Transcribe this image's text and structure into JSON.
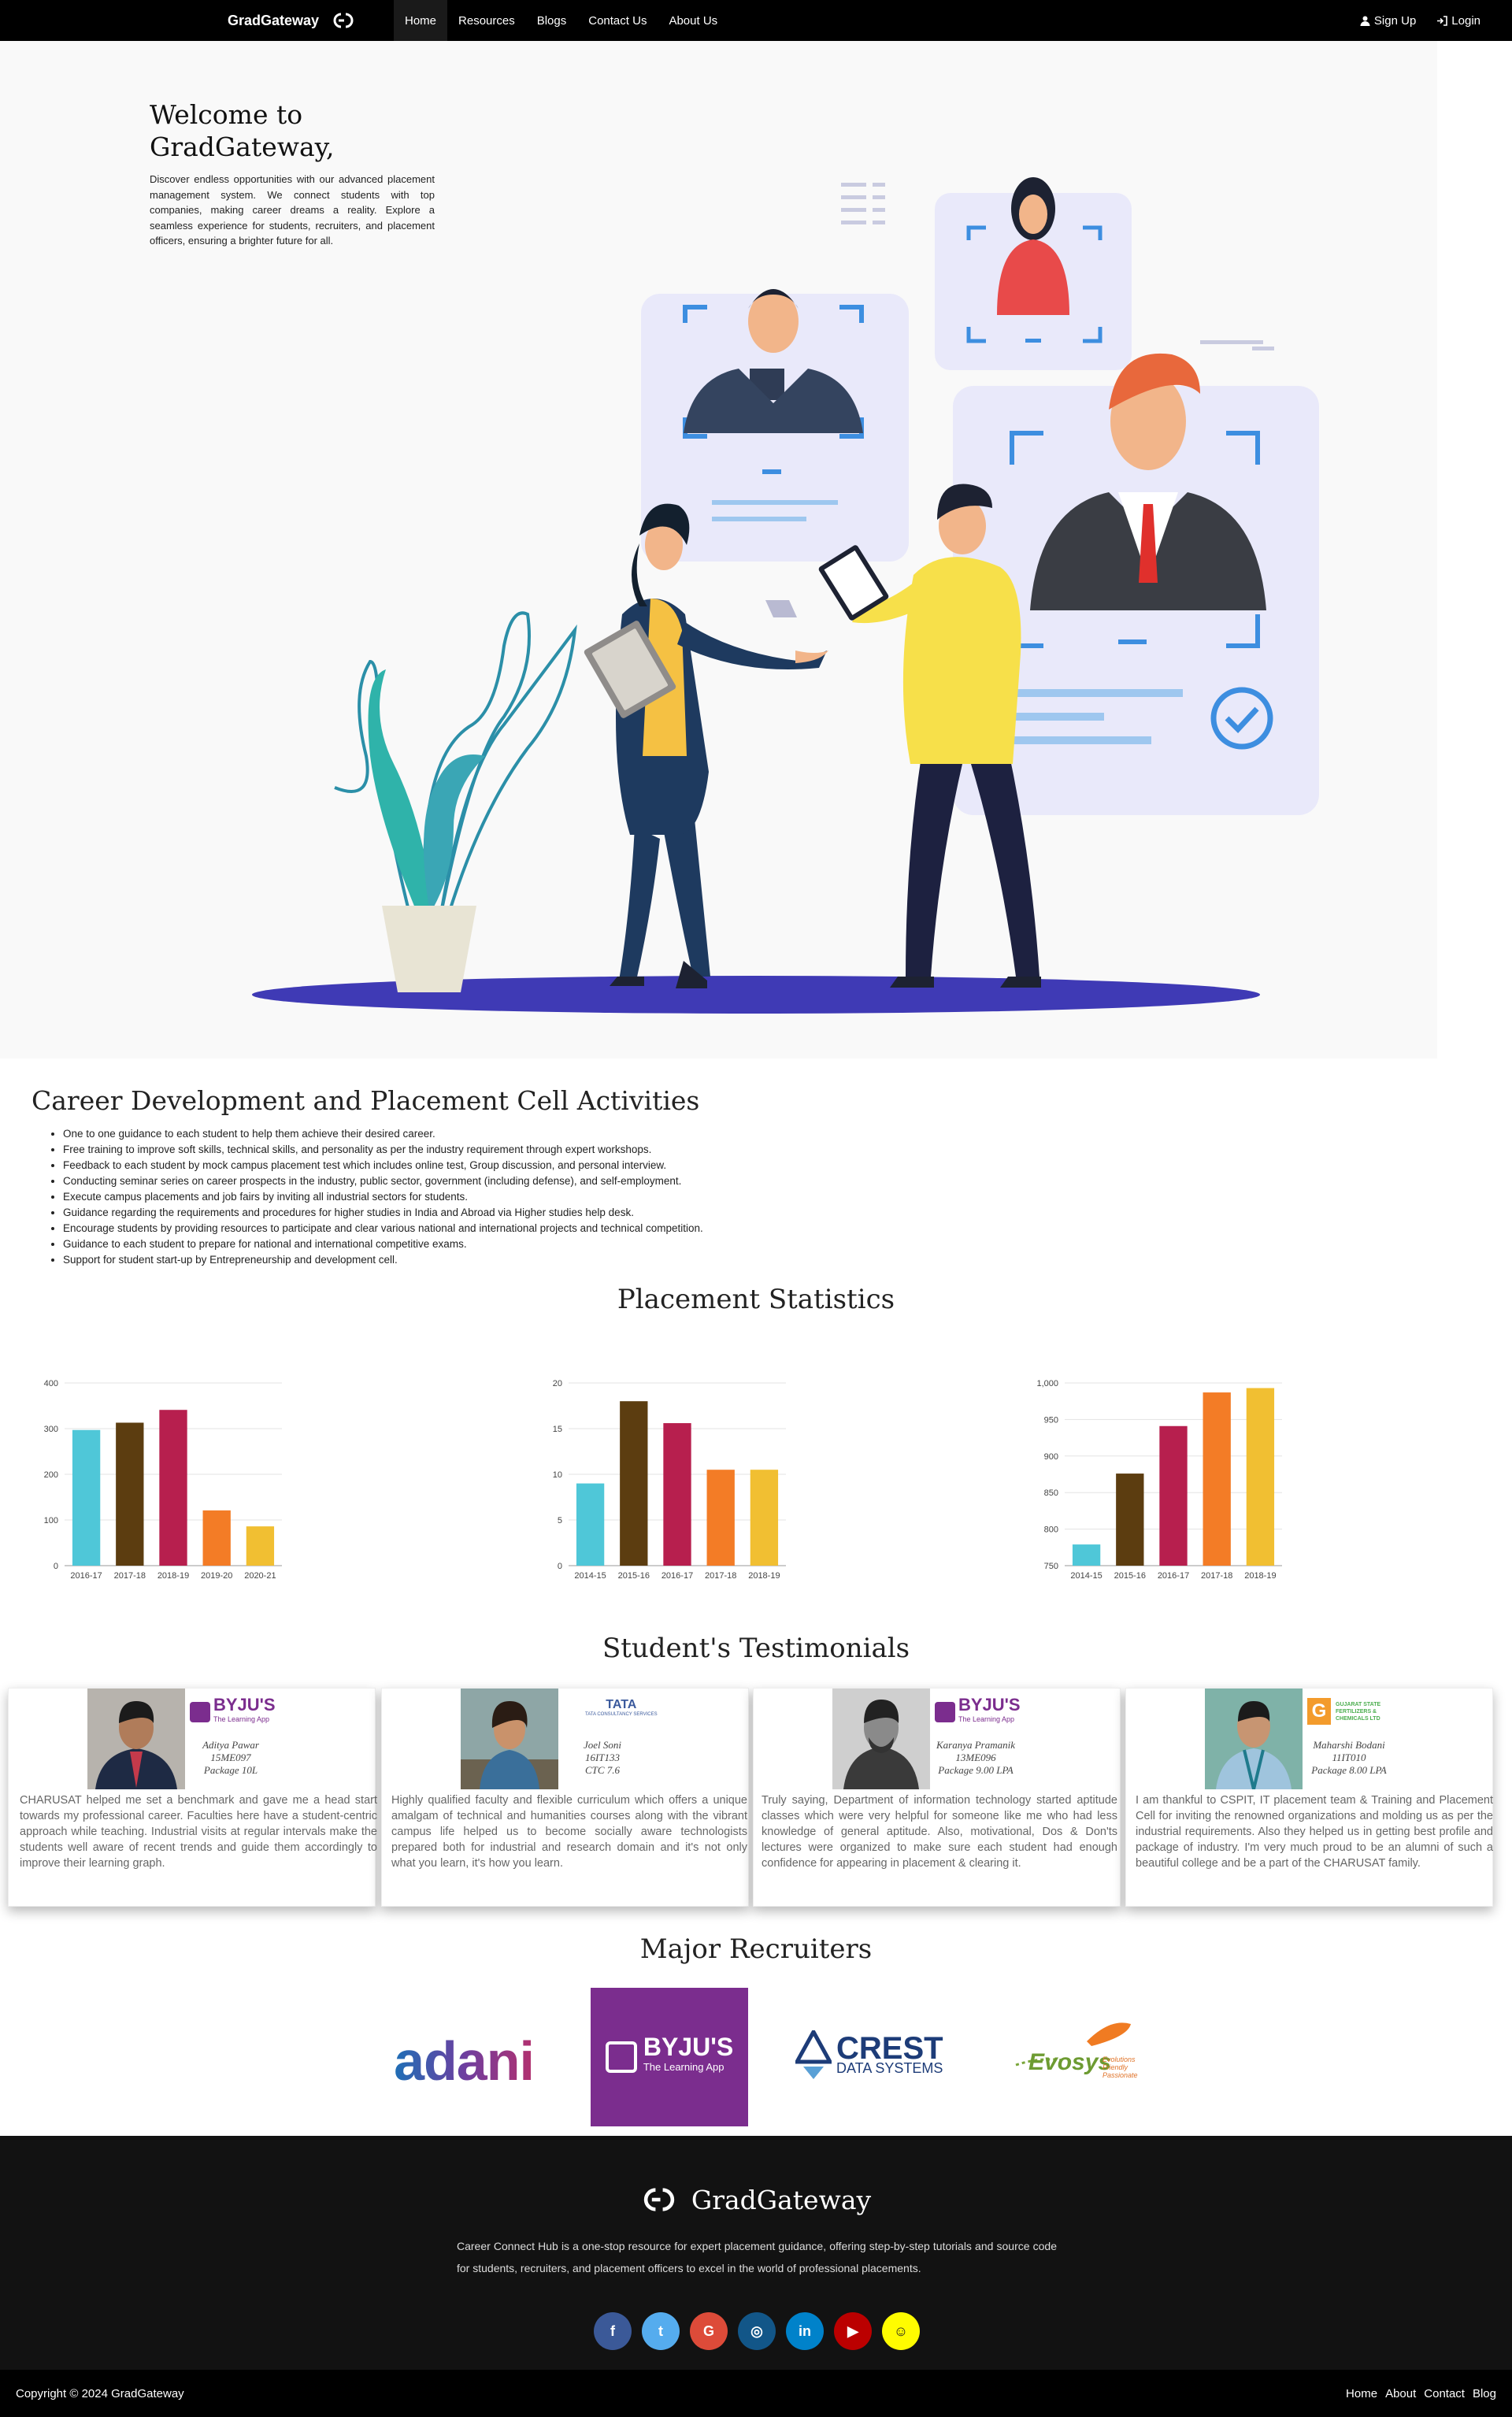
{
  "nav": {
    "brand": "GradGateway",
    "links": [
      "Home",
      "Resources",
      "Blogs",
      "Contact Us",
      "About Us"
    ],
    "signup": "Sign Up",
    "login": "Login"
  },
  "hero": {
    "title_line1": "Welcome to",
    "title_line2": "GradGateway,",
    "text": "Discover endless opportunities with our advanced placement management system. We connect students with top companies, making career dreams a reality. Explore a seamless experience for students, recruiters, and placement officers, ensuring a brighter future for all."
  },
  "career": {
    "title": "Career Development and Placement Cell Activities",
    "items": [
      "One to one guidance to each student to help them achieve their desired career.",
      "Free training to improve soft skills, technical skills, and personality as per the industry requirement through expert workshops.",
      "Feedback to each student by mock campus placement test which includes online test, Group discussion, and personal interview.",
      "Conducting seminar series on career prospects in the industry, public sector, government (including defense), and self-employment.",
      "Execute campus placements and job fairs by inviting all industrial sectors for students.",
      "Guidance regarding the requirements and procedures for higher studies in India and Abroad via Higher studies help desk.",
      "Encourage students by providing resources to participate and clear various national and international projects and technical competition.",
      "Guidance to each student to prepare for national and international competitive exams.",
      "Support for student start-up by Entrepreneurship and development cell."
    ]
  },
  "stats": {
    "title": "Placement Statistics"
  },
  "chart_data": [
    {
      "type": "bar",
      "categories": [
        "2016-17",
        "2017-18",
        "2018-19",
        "2019-20",
        "2020-21"
      ],
      "values": [
        297,
        313,
        341,
        121,
        86
      ],
      "ylim": [
        0,
        400
      ],
      "yticks": [
        "0",
        "100",
        "200",
        "300",
        "400"
      ],
      "colors": [
        "#4fc7d8",
        "#5c3d10",
        "#b71f4e",
        "#f37c26",
        "#f1bf32"
      ],
      "grid": true
    },
    {
      "type": "bar",
      "categories": [
        "2014-15",
        "2015-16",
        "2016-17",
        "2017-18",
        "2018-19"
      ],
      "values": [
        9,
        18,
        15.6,
        10.5,
        10.5
      ],
      "ylim": [
        0,
        20
      ],
      "yticks": [
        "0",
        "5",
        "10",
        "15",
        "20"
      ],
      "colors": [
        "#4fc7d8",
        "#5c3d10",
        "#b71f4e",
        "#f37c26",
        "#f1bf32"
      ],
      "grid": true
    },
    {
      "type": "bar",
      "categories": [
        "2014-15",
        "2015-16",
        "2016-17",
        "2017-18",
        "2018-19"
      ],
      "values": [
        779,
        876,
        941,
        987,
        993
      ],
      "ylim": [
        750,
        1000
      ],
      "yticks": [
        "750",
        "800",
        "850",
        "900",
        "950",
        "1,000"
      ],
      "colors": [
        "#4fc7d8",
        "#5c3d10",
        "#b71f4e",
        "#f37c26",
        "#f1bf32"
      ],
      "grid": true
    }
  ],
  "testimonials": {
    "title": "Student's Testimonials",
    "cards": [
      {
        "company": "BYJU'S",
        "company_sub": "The Learning App",
        "name": "Aditya Pawar",
        "id": "15ME097",
        "package": "Package 10L",
        "text": "CHARUSAT helped me set a benchmark and gave me a head start towards my professional career. Faculties here have a student-centric approach while teaching. Industrial visits at regular intervals make the students well aware of recent trends and guide them accordingly to improve their learning graph."
      },
      {
        "company": "TATA",
        "company_sub": "TATA CONSULTANCY SERVICES",
        "name": "Joel Soni",
        "id": "16IT133",
        "package": "CTC 7.6",
        "text": "Highly qualified faculty and flexible curriculum which offers a unique amalgam of technical and humanities courses along with the vibrant campus life helped us to become socially aware technologists prepared both for industrial and research domain and it's not only what you learn, it's how you learn."
      },
      {
        "company": "BYJU'S",
        "company_sub": "The Learning App",
        "name": "Karanya Pramanik",
        "id": "13ME096",
        "package": "Package 9.00 LPA",
        "text": "Truly saying, Department of information technology started aptitude classes which were very helpful for someone like me who had less knowledge of general aptitude. Also, motivational, Dos & Don'ts lectures were organized to make sure each student had enough confidence for appearing in placement & clearing it."
      },
      {
        "company": "GUJARAT STATE FERTILIZERS & CHEMICALS LTD",
        "company_sub": "",
        "name": "Maharshi Bodani",
        "id": "11IT010",
        "package": "Package 8.00 LPA",
        "text": "I am thankful to CSPIT, IT placement team & Training and Placement Cell for inviting the renowned organizations and molding us as per the industrial requirements. Also they helped us in getting best profile and package of industry. I'm very much proud to be an alumni of such a beautiful college and be a part of the CHARUSAT family."
      }
    ]
  },
  "recruiters": {
    "title": "Major Recruiters",
    "logos": [
      {
        "name": "adani"
      },
      {
        "name": "BYJU'S",
        "sub": "The Learning App"
      },
      {
        "name": "CREST",
        "sub": "DATA SYSTEMS"
      },
      {
        "name": "Evosys",
        "sub": "Evolutions Friendly Passionate"
      }
    ]
  },
  "footer": {
    "brand": "GradGateway",
    "description": "Career Connect Hub is a one-stop resource for expert placement guidance, offering step-by-step tutorials and source code for students, recruiters, and placement officers to excel in the world of professional placements.",
    "socials": [
      {
        "icon": "facebook-icon",
        "glyph": "f",
        "color": "#3b5998"
      },
      {
        "icon": "twitter-icon",
        "glyph": "t",
        "color": "#55acee"
      },
      {
        "icon": "google-icon",
        "glyph": "G",
        "color": "#dd4b39"
      },
      {
        "icon": "instagram-icon",
        "glyph": "◎",
        "color": "#125688"
      },
      {
        "icon": "linkedin-icon",
        "glyph": "in",
        "color": "#0082ca"
      },
      {
        "icon": "youtube-icon",
        "glyph": "▶",
        "color": "#bb0000"
      },
      {
        "icon": "snapchat-icon",
        "glyph": "☺",
        "color": "#fffc00"
      }
    ],
    "copyright": "Copyright © 2024 GradGateway",
    "links": [
      "Home",
      "About",
      "Contact",
      "Blog"
    ]
  }
}
